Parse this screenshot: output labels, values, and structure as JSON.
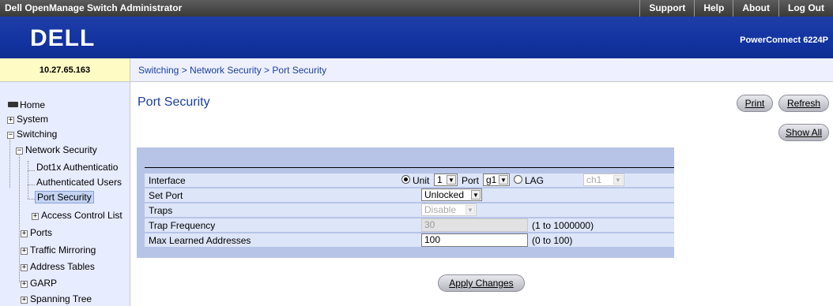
{
  "topbar": {
    "title": "Dell OpenManage Switch Administrator",
    "links": [
      "Support",
      "Help",
      "About",
      "Log Out"
    ]
  },
  "banner": {
    "logo": "DELL",
    "product": "PowerConnect 6224P"
  },
  "ip": "10.27.65.163",
  "breadcrumb": "Switching > Network Security > Port Security",
  "sidebar": {
    "home": "Home",
    "system": "System",
    "switching": "Switching",
    "network_security": "Network Security",
    "dot1x": "Dot1x Authenticatio",
    "auth_users": "Authenticated Users",
    "port_security": "Port Security",
    "acl": "Access Control List",
    "ports": "Ports",
    "traffic_mirroring": "Traffic Mirroring",
    "address_tables": "Address Tables",
    "garp": "GARP",
    "spanning_tree": "Spanning Tree"
  },
  "page": {
    "title": "Port Security",
    "print": "Print",
    "refresh": "Refresh",
    "show_all": "Show All",
    "apply": "Apply Changes"
  },
  "form": {
    "interface_label": "Interface",
    "unit_label": "Unit",
    "unit_value": "1",
    "port_label": "Port",
    "port_value": "g1",
    "lag_label": "LAG",
    "lag_value": "ch1",
    "set_port_label": "Set Port",
    "set_port_value": "Unlocked",
    "traps_label": "Traps",
    "traps_value": "Disable",
    "trap_freq_label": "Trap Frequency",
    "trap_freq_value": "30",
    "trap_freq_range": "(1 to 1000000)",
    "max_learned_label": "Max Learned Addresses",
    "max_learned_value": "100",
    "max_learned_range": "(0 to 100)"
  }
}
